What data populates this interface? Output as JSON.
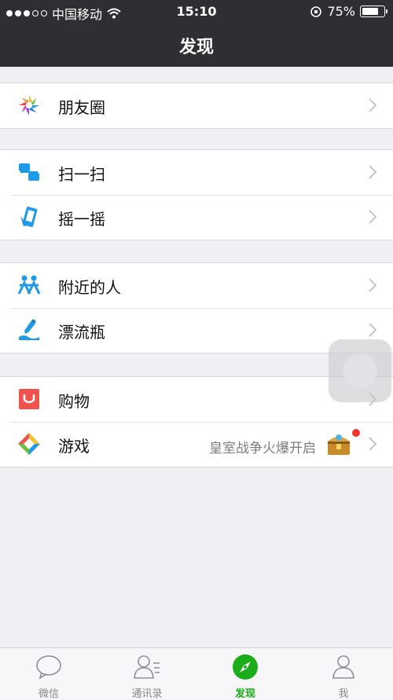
{
  "status_bar": {
    "carrier": "中国移动",
    "time": "15:10",
    "battery": "75%",
    "battery_level": 0.75
  },
  "nav": {
    "title": "发现"
  },
  "groups": [
    {
      "items": [
        {
          "label": "朋友圈",
          "icon": "moments-icon"
        }
      ]
    },
    {
      "items": [
        {
          "label": "扫一扫",
          "icon": "scan-icon"
        },
        {
          "label": "摇一摇",
          "icon": "shake-icon"
        }
      ]
    },
    {
      "items": [
        {
          "label": "附近的人",
          "icon": "people-nearby-icon"
        },
        {
          "label": "漂流瓶",
          "icon": "drift-bottle-icon"
        }
      ]
    },
    {
      "items": [
        {
          "label": "购物",
          "icon": "shopping-icon"
        },
        {
          "label": "游戏",
          "icon": "games-icon",
          "extra": "皇室战争火爆开启"
        }
      ]
    }
  ],
  "tabs": [
    {
      "label": "微信",
      "icon": "chat-icon",
      "active": false
    },
    {
      "label": "通讯录",
      "icon": "contacts-icon",
      "active": false
    },
    {
      "label": "发现",
      "icon": "compass-icon",
      "active": true
    },
    {
      "label": "我",
      "icon": "person-icon",
      "active": false
    }
  ],
  "colors": {
    "nav_bg": "#2f2f33",
    "page_bg": "#efeff4",
    "accent_green": "#1aad19",
    "badge_red": "#f43530"
  }
}
